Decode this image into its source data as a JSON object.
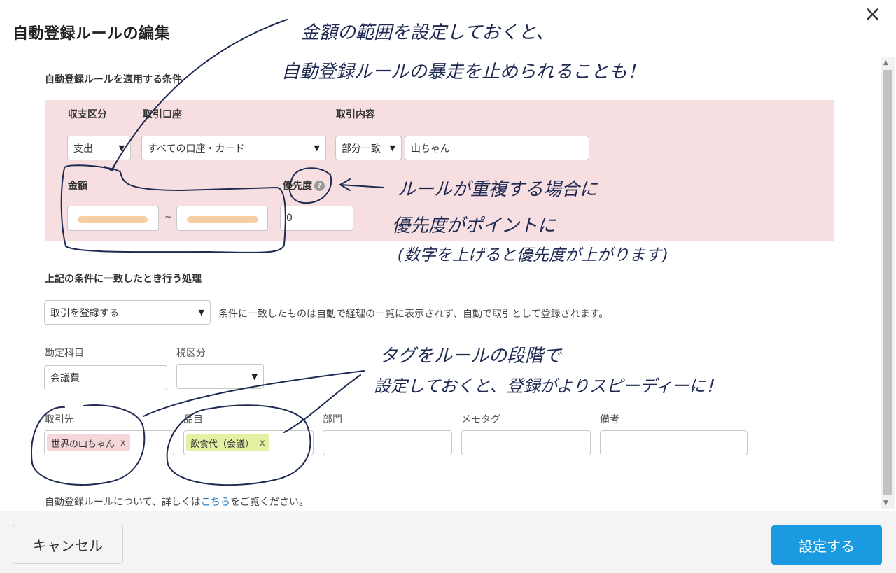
{
  "dialog": {
    "title": "自動登録ルールの編集",
    "close_icon": "×"
  },
  "conditions": {
    "heading": "自動登録ルールを適用する条件",
    "income_type": {
      "label": "収支区分",
      "value": "支出"
    },
    "account": {
      "label": "取引口座",
      "value": "すべての口座・カード"
    },
    "content": {
      "label": "取引内容",
      "match_value": "部分一致",
      "value": "山ちゃん"
    },
    "amount": {
      "label": "金額",
      "min": "",
      "max": "",
      "separator": "~"
    },
    "priority": {
      "label": "優先度",
      "value": "0"
    }
  },
  "action": {
    "heading": "上記の条件に一致したとき行う処理",
    "value": "取引を登録する",
    "description": "条件に一致したものは自動で経理の一覧に表示されず、自動で取引として登録されます。"
  },
  "fields": {
    "account_item": {
      "label": "勘定科目",
      "value": "会議費"
    },
    "tax_category": {
      "label": "税区分",
      "value": ""
    },
    "partner": {
      "label": "取引先",
      "tag": "世界の山ちゃん",
      "tag_color": "#f5d7d9"
    },
    "item": {
      "label": "品目",
      "tag": "飲食代（会議）",
      "tag_color": "#e6f0a3"
    },
    "department": {
      "label": "部門",
      "value": ""
    },
    "memo_tag": {
      "label": "メモタグ",
      "value": ""
    },
    "remarks": {
      "label": "備考",
      "value": ""
    }
  },
  "help": {
    "prefix": "自動登録ルールについて、詳しくは",
    "link": "こちら",
    "suffix": "をご覧ください。"
  },
  "footer": {
    "cancel_label": "キャンセル",
    "submit_label": "設定する",
    "submit_color": "#1a9ae0"
  },
  "annotations": {
    "note1_line1": "金額の範囲を設定しておくと、",
    "note1_line2": "自動登録ルールの暴走を止められることも！",
    "note2_line1": "ルールが重複する場合に",
    "note2_line2": "優先度がポイントに",
    "note2_line3": "(数字を上げると優先度が上がります)",
    "note3_line1": "タグをルールの段階で",
    "note3_line2": "設定しておくと、登録がよりスピーディーに！"
  }
}
